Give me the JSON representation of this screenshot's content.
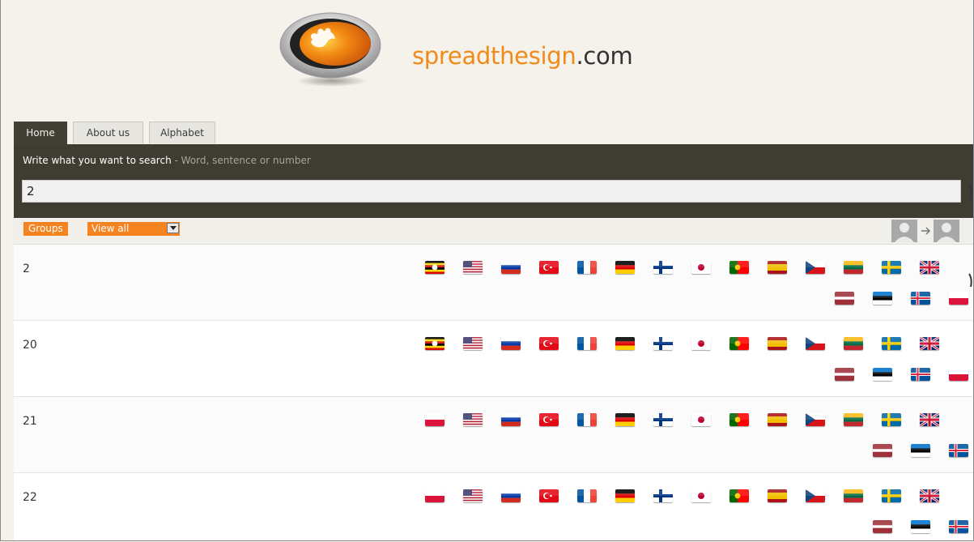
{
  "header": {
    "logo_brand": "spreadthesign",
    "logo_tld": ".com"
  },
  "tabs": [
    {
      "label": "Home",
      "active": true
    },
    {
      "label": "About us",
      "active": false
    },
    {
      "label": "Alphabet",
      "active": false
    }
  ],
  "search": {
    "label": "Write what you want to search",
    "hint": " - Word, sentence or number",
    "value": "2"
  },
  "filter": {
    "groups_label": "Groups",
    "select_value": "View all"
  },
  "results": [
    {
      "word": "2",
      "flags": [
        "uganda",
        "usa",
        "russia",
        "turkey",
        "france",
        "germany",
        "finland",
        "japan",
        "portugal",
        "spain",
        "czech",
        "lithuania",
        "sweden",
        "uk",
        "latvia",
        "estonia",
        "iceland",
        "poland"
      ]
    },
    {
      "word": "20",
      "flags": [
        "uganda",
        "usa",
        "russia",
        "turkey",
        "france",
        "germany",
        "finland",
        "japan",
        "portugal",
        "spain",
        "czech",
        "lithuania",
        "sweden",
        "uk",
        "latvia",
        "estonia",
        "iceland",
        "poland"
      ]
    },
    {
      "word": "21",
      "flags": [
        "poland",
        "usa",
        "russia",
        "turkey",
        "france",
        "germany",
        "finland",
        "japan",
        "portugal",
        "spain",
        "czech",
        "lithuania",
        "sweden",
        "uk",
        "latvia",
        "estonia",
        "iceland"
      ]
    },
    {
      "word": "22",
      "flags": [
        "poland",
        "usa",
        "russia",
        "turkey",
        "france",
        "germany",
        "finland",
        "japan",
        "portugal",
        "spain",
        "czech",
        "lithuania",
        "sweden",
        "uk",
        "latvia",
        "estonia",
        "iceland"
      ]
    }
  ],
  "colors": {
    "accent": "#f5831f",
    "panel": "#3f3c31",
    "page_bg": "#f4f2ea"
  }
}
